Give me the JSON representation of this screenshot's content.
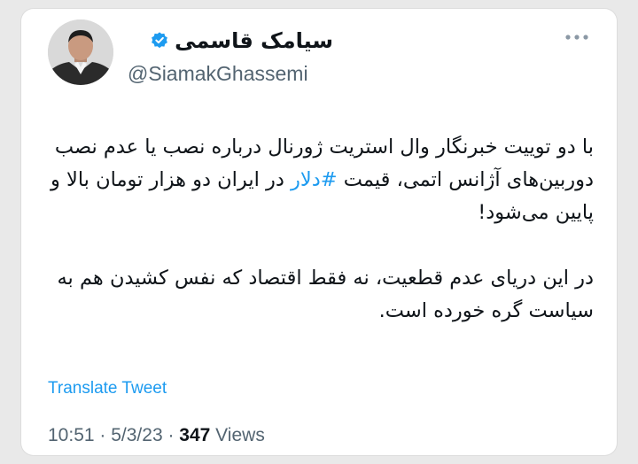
{
  "author": {
    "display_name": "سیامک قاسمی",
    "handle": "@SiamakGhassemi",
    "verified": true,
    "avatar": "profile-photo"
  },
  "tweet": {
    "para1_before": "با دو توییت خبرنگار وال استریت ژورنال درباره نصب یا عدم نصب دوربین‌های آژانس اتمی، قیمت ",
    "hashtag": "#دلار",
    "para1_after": " در ایران دو هزار تومان بالا و پایین می‌شود!",
    "para2": "در این دریای عدم قطعیت، نه فقط اقتصاد که نفس کشیدن هم به سیاست گره خورده است."
  },
  "actions": {
    "translate_label": "Translate Tweet"
  },
  "meta": {
    "time": "10:51",
    "sep1": " · ",
    "date": "5/3/23",
    "sep2": " · ",
    "views_count": "347",
    "views_label": " Views"
  },
  "colors": {
    "accent": "#1d9bf0",
    "text": "#0f1419",
    "muted": "#536471",
    "background": "#e9e9e9"
  },
  "icons": {
    "verified": "verified-badge-icon",
    "more": "more-options-icon"
  }
}
